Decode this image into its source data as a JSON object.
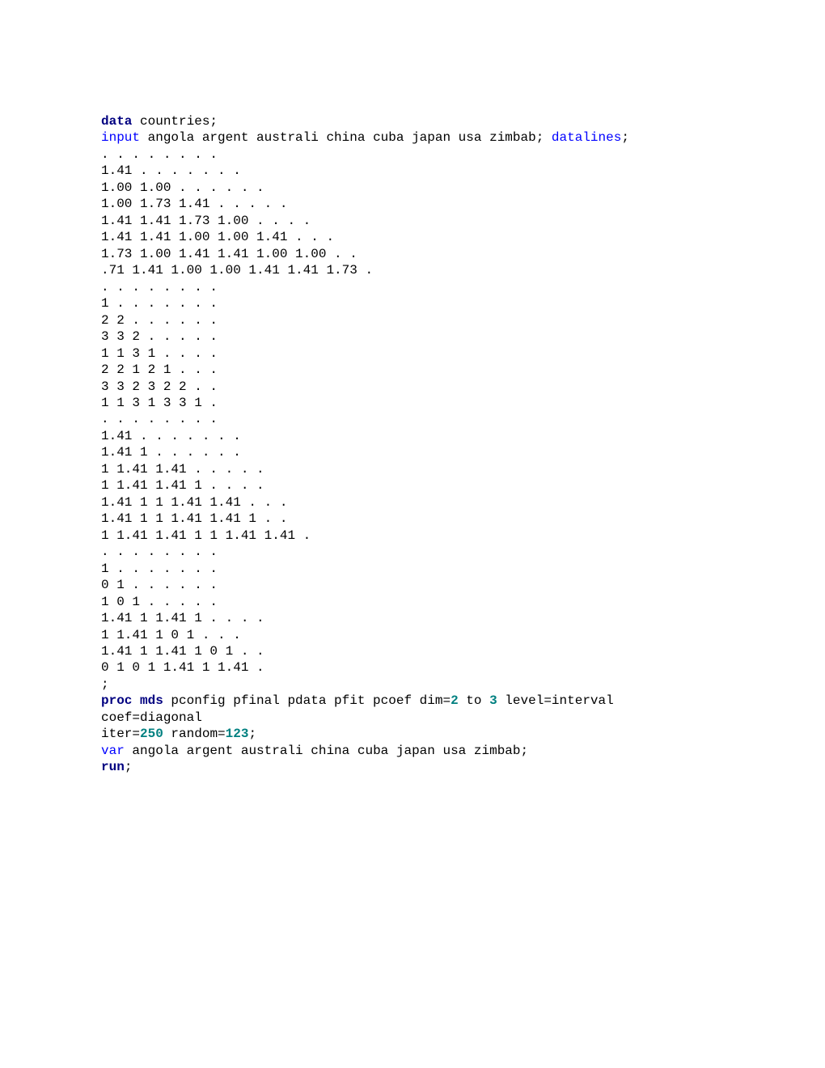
{
  "l1": {
    "a": "data",
    "b": " countries;"
  },
  "l2": {
    "a": "input",
    "b": " angola argent australi china cuba japan usa zimbab; ",
    "c": "datalines",
    "d": ";"
  },
  "l3": ". . . . . . . .",
  "l4": "1.41 . . . . . . .",
  "l5": "1.00 1.00 . . . . . .",
  "l6": "1.00 1.73 1.41 . . . . .",
  "l7": "1.41 1.41 1.73 1.00 . . . .",
  "l8": "1.41 1.41 1.00 1.00 1.41 . . .",
  "l9": "1.73 1.00 1.41 1.41 1.00 1.00 . .",
  "l10": ".71 1.41 1.00 1.00 1.41 1.41 1.73 .",
  "l11": ". . . . . . . .",
  "l12": "1 . . . . . . .",
  "l13": "2 2 . . . . . .",
  "l14": "3 3 2 . . . . .",
  "l15": "1 1 3 1 . . . .",
  "l16": "2 2 1 2 1 . . .",
  "l17": "3 3 2 3 2 2 . .",
  "l18": "1 1 3 1 3 3 1 .",
  "l19": ". . . . . . . .",
  "l20": "1.41 . . . . . . .",
  "l21": "1.41 1 . . . . . .",
  "l22": "1 1.41 1.41 . . . . .",
  "l23": "1 1.41 1.41 1 . . . .",
  "l24": "1.41 1 1 1.41 1.41 . . .",
  "l25": "1.41 1 1 1.41 1.41 1 . .",
  "l26": "1 1.41 1.41 1 1 1.41 1.41 .",
  "l27": ". . . . . . . .",
  "l28": "1 . . . . . . .",
  "l29": "0 1 . . . . . .",
  "l30": "1 0 1 . . . . .",
  "l31": "1.41 1 1.41 1 . . . .",
  "l32": "1 1.41 1 0 1 . . .",
  "l33": "1.41 1 1.41 1 0 1 . .",
  "l34": "0 1 0 1 1.41 1 1.41 .",
  "l35": ";",
  "l36": {
    "a": "proc mds",
    "b": " pconfig pfinal pdata pfit pcoef dim=",
    "c": "2",
    "d": " to ",
    "e": "3",
    "f": " level=interval"
  },
  "l37": "coef=diagonal",
  "l38": {
    "a": "iter=",
    "b": "250",
    "c": " random=",
    "d": "123",
    "e": ";"
  },
  "l39": {
    "a": "var",
    "b": " angola argent australi china cuba japan usa zimbab;"
  },
  "l40": {
    "a": "run",
    "b": ";"
  }
}
